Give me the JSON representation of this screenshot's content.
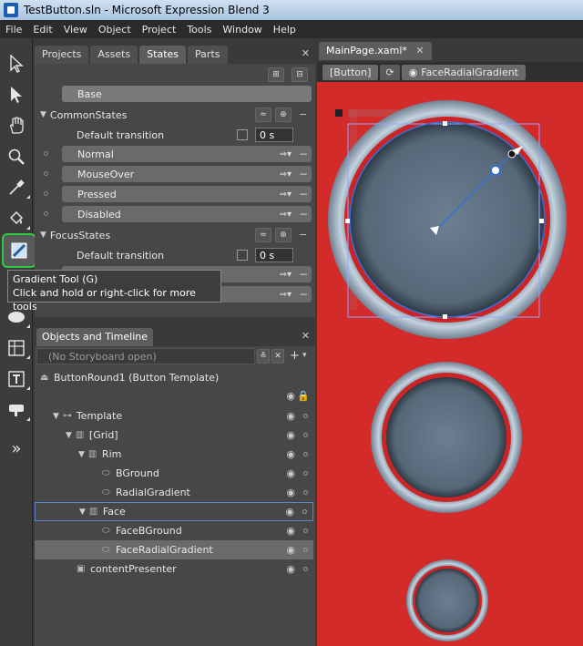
{
  "window": {
    "title": "TestButton.sln - Microsoft Expression Blend 3"
  },
  "menu": [
    "File",
    "Edit",
    "View",
    "Object",
    "Project",
    "Tools",
    "Window",
    "Help"
  ],
  "tool_icons": [
    "selection-arrow-icon",
    "direct-selection-icon",
    "pan-hand-icon",
    "zoom-icon",
    "eyedropper-icon",
    "paint-bucket-icon",
    "gradient-tool-icon",
    "ellipse-icon",
    "grid-layout-icon",
    "text-icon",
    "asset-tool-icon",
    "more-tools-icon"
  ],
  "states_panel": {
    "tabs": [
      "Projects",
      "Assets",
      "States",
      "Parts"
    ],
    "active_tab": "States",
    "base_label": "Base",
    "groups": [
      {
        "name": "CommonStates",
        "default_transition_label": "Default transition",
        "default_transition_value": "0 s",
        "states": [
          "Normal",
          "MouseOver",
          "Pressed",
          "Disabled"
        ]
      },
      {
        "name": "FocusStates",
        "default_transition_label": "Default transition",
        "default_transition_value": "0 s"
      }
    ]
  },
  "tooltip": {
    "title": "Gradient Tool (G)",
    "hint": "Click and hold or right-click for more tools"
  },
  "objects_panel": {
    "title": "Objects and Timeline",
    "storyboard": "(No Storyboard open)",
    "root": "ButtonRound1 (Button Template)",
    "tree": [
      {
        "label": "Template",
        "indent": 1,
        "icon": "template-icon",
        "expand": true
      },
      {
        "label": "[Grid]",
        "indent": 2,
        "icon": "grid-icon",
        "expand": true
      },
      {
        "label": "Rim",
        "indent": 3,
        "icon": "grid-icon",
        "expand": true
      },
      {
        "label": "BGround",
        "indent": 4,
        "icon": "ellipse-icon"
      },
      {
        "label": "RadialGradient",
        "indent": 4,
        "icon": "ellipse-icon"
      },
      {
        "label": "Face",
        "indent": 3,
        "icon": "grid-icon",
        "expand": true,
        "outlined": true
      },
      {
        "label": "FaceBGround",
        "indent": 4,
        "icon": "ellipse-icon"
      },
      {
        "label": "FaceRadialGradient",
        "indent": 4,
        "icon": "ellipse-icon",
        "selected": true
      },
      {
        "label": "contentPresenter",
        "indent": 2,
        "icon": "content-presenter-icon"
      }
    ]
  },
  "document": {
    "tab": "MainPage.xaml*",
    "breadcrumb": [
      "[Button]",
      "FaceRadialGradient"
    ]
  },
  "colors": {
    "canvas": "#d32a2a",
    "selection_green": "#2ecc40"
  }
}
